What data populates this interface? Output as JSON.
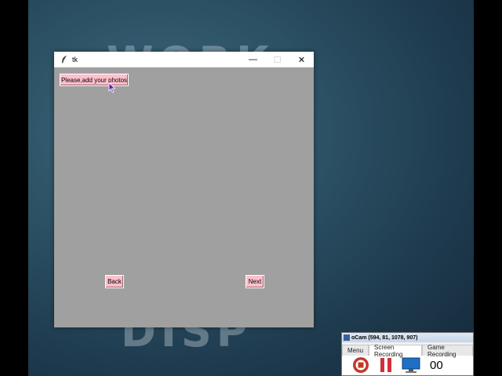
{
  "wallpaper": {
    "word_top": "WORK",
    "word_bottom": "DISP"
  },
  "tk_window": {
    "title": "tk",
    "controls": {
      "minimize": "—",
      "maximize": "☐",
      "close": "✕"
    },
    "buttons": {
      "add_photos": "Please,add your photos",
      "back": "Back",
      "next": "Next"
    },
    "colors": {
      "background": "#a0a0a0",
      "button": "#ffc0cb"
    }
  },
  "ocam": {
    "title": "oCam (594, 81, 1078, 907)",
    "tabs": [
      "Menu",
      "Screen Recording",
      "Game Recording"
    ],
    "tools": [
      "record-icon",
      "pause-icon",
      "screen-icon"
    ],
    "timer": "00"
  }
}
